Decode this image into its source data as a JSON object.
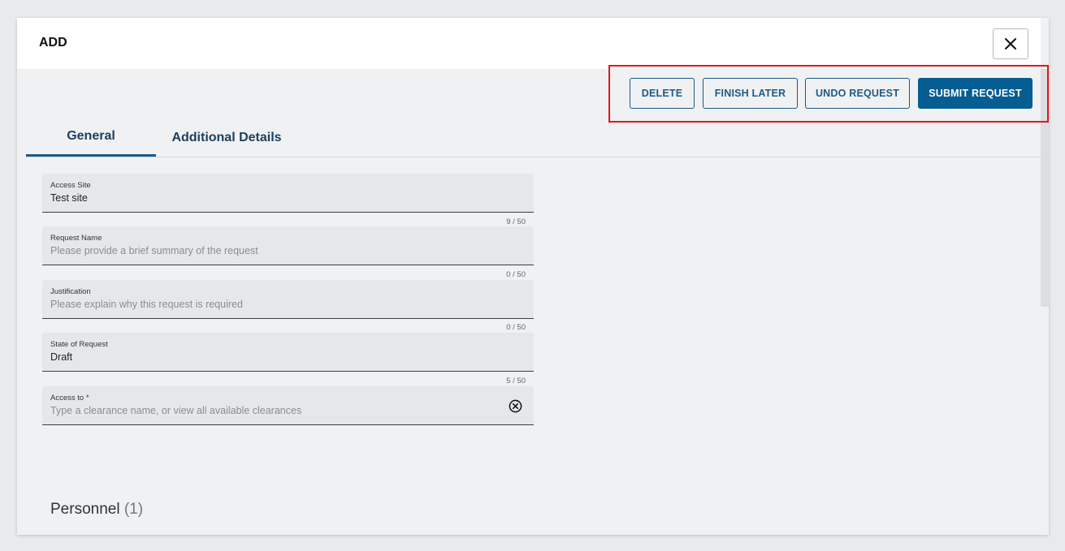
{
  "dialog": {
    "title": "ADD",
    "close_icon": "close-icon"
  },
  "actions": {
    "delete": "DELETE",
    "finish_later": "FINISH LATER",
    "undo_request": "UNDO REQUEST",
    "submit_request": "SUBMIT REQUEST"
  },
  "tabs": [
    {
      "label": "General",
      "active": true
    },
    {
      "label": "Additional Details",
      "active": false
    }
  ],
  "fields": {
    "access_site": {
      "label": "Access Site",
      "value": "Test site",
      "counter": "9 / 50"
    },
    "request_name": {
      "label": "Request Name",
      "placeholder": "Please provide a brief summary of the request",
      "counter": "0 / 50"
    },
    "justification": {
      "label": "Justification",
      "placeholder": "Please explain why this request is required",
      "counter": "0 / 50"
    },
    "state_of_request": {
      "label": "State of Request",
      "value": "Draft",
      "counter": "5 / 50"
    },
    "access_to": {
      "label": "Access to *",
      "placeholder": "Type a clearance name, or view all available clearances"
    }
  },
  "personnel": {
    "title": "Personnel",
    "count": "(1)"
  },
  "colors": {
    "primary": "#055d92",
    "highlight": "#e3161b"
  }
}
